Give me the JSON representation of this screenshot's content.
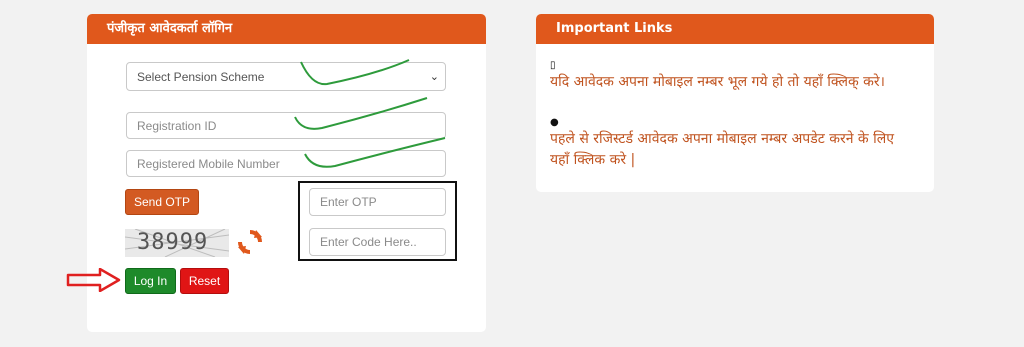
{
  "login": {
    "header": "पंजीकृत आवेदकर्ता लॉगिन",
    "scheme_select": "Select Pension Scheme",
    "registration_placeholder": "Registration ID",
    "mobile_placeholder": "Registered Mobile Number",
    "send_otp_label": "Send OTP",
    "otp_placeholder": "Enter OTP",
    "code_placeholder": "Enter Code Here..",
    "captcha_text": "38999",
    "login_label": "Log In",
    "reset_label": "Reset"
  },
  "links": {
    "header": "Important Links",
    "items": [
      {
        "icon": "mobile-icon",
        "text": "यदि आवेदक अपना मोबाइल नम्बर भूल गये हो तो यहाँ क्लिक् करे।"
      },
      {
        "icon": "user-icon",
        "text": "पहले से रजिस्टर्ड आवेदक अपना मोबाइल नम्बर अपडेट करने के लिए यहाँ क्लिक करे |"
      }
    ]
  },
  "colors": {
    "header": "#e0581c",
    "send_otp": "#d35a22",
    "login": "#1e8a2a",
    "reset": "#e01515",
    "link_text": "#c0531f",
    "annotation_green": "#2e9b3c",
    "annotation_red": "#e02020"
  }
}
